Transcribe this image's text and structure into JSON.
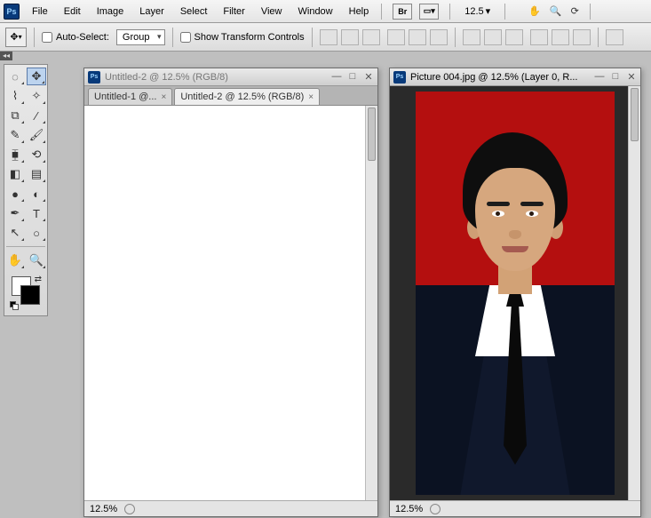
{
  "app": {
    "logo_text": "Ps"
  },
  "menu": {
    "items": [
      "File",
      "Edit",
      "Image",
      "Layer",
      "Select",
      "Filter",
      "View",
      "Window",
      "Help"
    ],
    "bridge_label": "Br",
    "zoom_value": "12.5",
    "zoom_arrow": "▾"
  },
  "options": {
    "auto_select_label": "Auto-Select:",
    "auto_select_value": "Group",
    "show_transform_label": "Show Transform Controls"
  },
  "tools": {
    "items": [
      {
        "name": "marquee-tool",
        "glyph": "◌"
      },
      {
        "name": "move-tool",
        "glyph": "✥",
        "selected": true
      },
      {
        "name": "lasso-tool",
        "glyph": "⌇"
      },
      {
        "name": "magic-wand-tool",
        "glyph": "✧"
      },
      {
        "name": "crop-tool",
        "glyph": "⧉"
      },
      {
        "name": "eyedropper-tool",
        "glyph": "∕"
      },
      {
        "name": "healing-brush-tool",
        "glyph": "✎"
      },
      {
        "name": "brush-tool",
        "glyph": "🖌"
      },
      {
        "name": "clone-stamp-tool",
        "glyph": "⧯"
      },
      {
        "name": "history-brush-tool",
        "glyph": "⟲"
      },
      {
        "name": "eraser-tool",
        "glyph": "◧"
      },
      {
        "name": "gradient-tool",
        "glyph": "▤"
      },
      {
        "name": "blur-tool",
        "glyph": "●"
      },
      {
        "name": "dodge-tool",
        "glyph": "◐"
      },
      {
        "name": "pen-tool",
        "glyph": "✒"
      },
      {
        "name": "type-tool",
        "glyph": "T"
      },
      {
        "name": "path-selection-tool",
        "glyph": "↖"
      },
      {
        "name": "shape-tool",
        "glyph": "○"
      },
      {
        "name": "hand-tool",
        "glyph": "✋"
      },
      {
        "name": "zoom-tool",
        "glyph": "🔍"
      }
    ]
  },
  "windows": {
    "left": {
      "title": "Untitled-2 @ 12.5% (RGB/8)",
      "tabs": [
        {
          "label": "Untitled-1 @...",
          "active": false
        },
        {
          "label": "Untitled-2 @ 12.5% (RGB/8)",
          "active": true
        }
      ],
      "status_zoom": "12.5%"
    },
    "right": {
      "title": "Picture 004.jpg @ 12.5% (Layer 0, R...",
      "status_zoom": "12.5%"
    }
  },
  "win_buttons": {
    "min": "—",
    "max": "□",
    "close": "✕"
  }
}
